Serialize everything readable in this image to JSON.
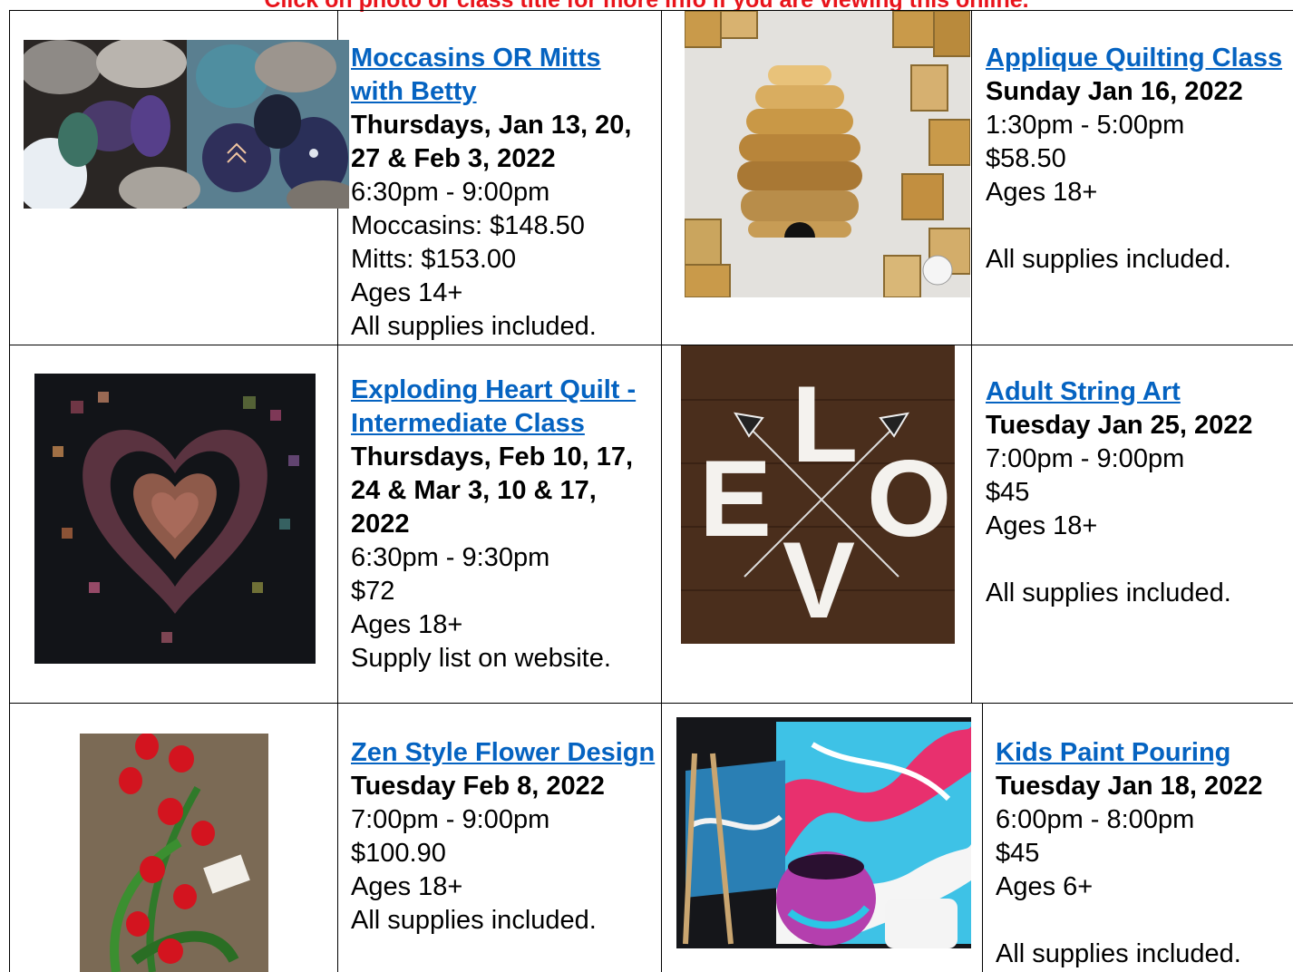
{
  "header": {
    "notice": "Click on photo or class title for more info if you are viewing this online."
  },
  "classes": [
    {
      "title": "Moccasins OR Mitts with Betty",
      "when": "Thursdays, Jan 13, 20, 27 & Feb 3, 2022",
      "lines": [
        "6:30pm - 9:00pm",
        "Moccasins: $148.50",
        "Mitts: $153.00",
        "Ages 14+",
        "All supplies included."
      ]
    },
    {
      "title": "Applique Quilting Class",
      "when": "Sunday Jan 16, 2022",
      "lines": [
        "1:30pm - 5:00pm",
        "$58.50",
        "Ages 18+",
        "",
        "All supplies included."
      ]
    },
    {
      "title": "Exploding Heart Quilt - Intermediate Class",
      "when": "Thursdays, Feb 10, 17, 24 & Mar 3, 10 & 17, 2022",
      "lines": [
        "6:30pm - 9:30pm",
        "$72",
        "Ages 18+",
        "Supply list on website."
      ]
    },
    {
      "title": "Adult String Art",
      "when": "Tuesday Jan 25, 2022",
      "lines": [
        "7:00pm - 9:00pm",
        "$45",
        "Ages 18+",
        "",
        "All supplies included."
      ]
    },
    {
      "title": "Zen Style Flower Design",
      "when": "Tuesday Feb 8, 2022",
      "lines": [
        "7:00pm - 9:00pm",
        "$100.90",
        "Ages 18+",
        "All supplies included."
      ]
    },
    {
      "title": "Kids Paint Pouring",
      "when": "Tuesday Jan 18, 2022",
      "lines": [
        "6:00pm - 8:00pm",
        "$45",
        "Ages 6+",
        "",
        "All supplies included."
      ]
    }
  ],
  "string_art_letters": [
    "L",
    "E",
    "O",
    "V"
  ]
}
